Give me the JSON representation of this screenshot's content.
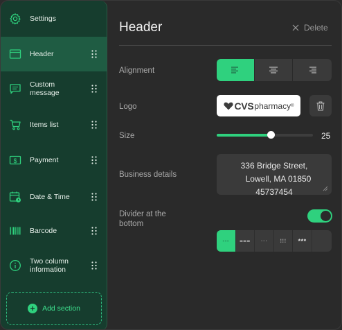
{
  "sidebar": {
    "items": [
      {
        "label": "Settings",
        "icon": "gear-icon"
      },
      {
        "label": "Header",
        "icon": "header-window-icon",
        "active": true
      },
      {
        "label": "Custom message",
        "icon": "message-icon"
      },
      {
        "label": "Items list",
        "icon": "cart-icon"
      },
      {
        "label": "Payment",
        "icon": "dollar-icon"
      },
      {
        "label": "Date & Time",
        "icon": "calendar-clock-icon"
      },
      {
        "label": "Barcode",
        "icon": "barcode-icon"
      },
      {
        "label": "Two column information",
        "icon": "info-icon"
      }
    ],
    "add_section_label": "Add section"
  },
  "panel": {
    "title": "Header",
    "delete_label": "Delete",
    "alignment": {
      "label": "Alignment",
      "options": [
        "left",
        "center",
        "right"
      ],
      "selected": "left"
    },
    "logo": {
      "label": "Logo",
      "brand": "CVS",
      "brand_suffix": "pharmacy",
      "reg_mark": "®"
    },
    "size": {
      "label": "Size",
      "value": "25",
      "fraction": 0.56
    },
    "business_details": {
      "label": "Business details",
      "lines": [
        "336 Bridge Street,",
        "Lowell, MA 01850",
        "45737454"
      ]
    },
    "divider": {
      "label_line1": "Divider at the",
      "label_line2": "bottom",
      "enabled": true,
      "styles": [
        "---",
        "===",
        "···",
        "⁝⁝⁝",
        "***",
        ""
      ],
      "selected_index": 0
    }
  },
  "colors": {
    "accent": "#2fd17e",
    "sidebar_bg": "#163d2e",
    "sidebar_active": "#1f5c43",
    "panel_bg": "#2a2a2a"
  }
}
